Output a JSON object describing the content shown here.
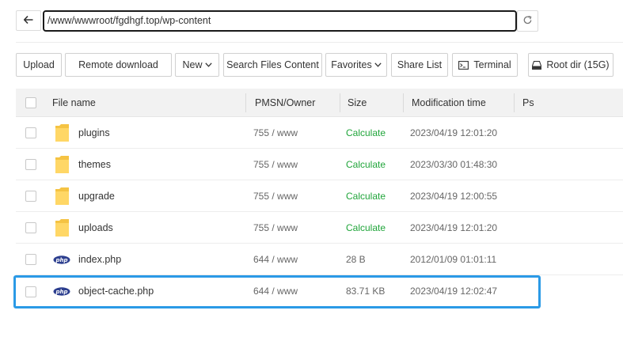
{
  "address_bar": {
    "path": "/www/wwwroot/fgdhgf.top/wp-content"
  },
  "toolbar": {
    "upload": "Upload",
    "remote_download": "Remote download",
    "new": "New",
    "search_files": "Search Files Content",
    "favorites": "Favorites",
    "share_list": "Share List",
    "terminal": "Terminal",
    "root_dir": "Root dir (15G)"
  },
  "table": {
    "headers": {
      "file_name": "File name",
      "permission": "PMSN/Owner",
      "size": "Size",
      "modified": "Modification time",
      "ps": "Ps"
    },
    "rows": [
      {
        "name": "plugins",
        "type": "folder",
        "permission": "755 / www",
        "size": "Calculate",
        "modified": "2023/04/19 12:01:20"
      },
      {
        "name": "themes",
        "type": "folder",
        "permission": "755 / www",
        "size": "Calculate",
        "modified": "2023/03/30 01:48:30"
      },
      {
        "name": "upgrade",
        "type": "folder",
        "permission": "755 / www",
        "size": "Calculate",
        "modified": "2023/04/19 12:00:55"
      },
      {
        "name": "uploads",
        "type": "folder",
        "permission": "755 / www",
        "size": "Calculate",
        "modified": "2023/04/19 12:01:20"
      },
      {
        "name": "index.php",
        "type": "php",
        "permission": "644 / www",
        "size": "28 B",
        "modified": "2012/01/09 01:01:11"
      },
      {
        "name": "object-cache.php",
        "type": "php",
        "permission": "644 / www",
        "size": "83.71 KB",
        "modified": "2023/04/19 12:02:47"
      }
    ]
  },
  "colors": {
    "calculate_link": "#20a53a",
    "highlight": "#2b9ae6",
    "folder": "#f5c343",
    "php_badge": "#2d3f8f"
  },
  "icons": {
    "back": "arrow-left-icon",
    "refresh": "refresh-icon",
    "terminal": "terminal-icon",
    "disk": "disk-icon",
    "folder": "folder-icon",
    "php": "php-icon"
  }
}
